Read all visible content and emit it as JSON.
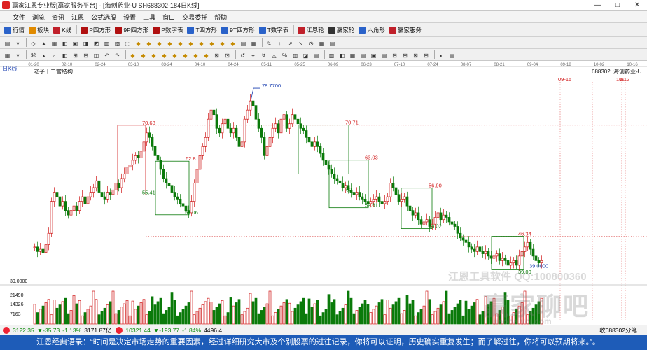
{
  "window": {
    "title": "赢家江恩专业版[赢家服务平台] - [海创药业-U SH688302-184日K线]",
    "controls": [
      "—",
      "□",
      "✕"
    ]
  },
  "menu": [
    "文件",
    "浏览",
    "资讯",
    "江恩",
    "公式选股",
    "设置",
    "工具",
    "窗口",
    "交易委托",
    "帮助"
  ],
  "toolbar1": [
    {
      "label": "行情",
      "icon": "grid-icon",
      "color": "#2a62c9"
    },
    {
      "label": "板块",
      "icon": "blocks-icon",
      "color": "#e08a00"
    },
    {
      "label": "K线",
      "icon": "kline-icon",
      "color": "#c0202a"
    },
    {
      "label": "P四方形",
      "icon": "square-p-icon",
      "color": "#b01010"
    },
    {
      "label": "9P四方形",
      "icon": "square-9p-icon",
      "color": "#b01010"
    },
    {
      "label": "P数字表",
      "icon": "table-p-icon",
      "color": "#b01010"
    },
    {
      "label": "T四方形",
      "icon": "square-t-icon",
      "color": "#2a62c9"
    },
    {
      "label": "9T四方形",
      "icon": "square-9t-icon",
      "color": "#2a62c9"
    },
    {
      "label": "T数字表",
      "icon": "table-t-icon",
      "color": "#2a62c9"
    },
    {
      "label": "江恩轮",
      "icon": "wheel-icon",
      "color": "#c0202a"
    },
    {
      "label": "赢家轮",
      "icon": "wheel2-icon",
      "color": "#333333"
    },
    {
      "label": "六角形",
      "icon": "hexagon-icon",
      "color": "#2a62c9"
    },
    {
      "label": "赢家服务",
      "icon": "service-icon",
      "color": "#c0202a"
    }
  ],
  "chart": {
    "period_label": "日K线",
    "title": "老子十二宫结构",
    "stock_code": "688302",
    "stock_name": "海创药业-U",
    "date_labels": [
      "01-20",
      "02-10",
      "02-24",
      "03-10",
      "03-24",
      "04-10",
      "04-24",
      "05-11",
      "05-25",
      "06-09",
      "06-23",
      "07-10",
      "07-24",
      "08-07",
      "08-21",
      "09-04",
      "09-18",
      "10-02",
      "10-16"
    ],
    "future_marks": [
      "09-15",
      "10-12",
      "11"
    ],
    "price_labels": [
      "78.7700",
      "70.68",
      "62.8",
      "55.41",
      "51.06",
      "70.71",
      "63.03",
      "60",
      "52.61",
      "56.90",
      "48.02",
      "46.34",
      "39.00",
      "39.0000"
    ],
    "left_axis": [
      "39.0000",
      "21490",
      "14326",
      "7163"
    ],
    "watermark1": "江恩工具软件  QQ:100800360",
    "watermark2": "赢家聊吧",
    "watermark3": "jiaoba.ycj.com"
  },
  "statusbar": {
    "sh_index": "3122.35",
    "sh_change": "▼-35.73",
    "sh_pct": "-1.13%",
    "sh_amount": "3171.87亿",
    "sz_index": "10321.44",
    "sz_change": "▼-193.77",
    "sz_pct": "-1.84%",
    "sz_amount": "4496.4",
    "right_text": "收688302分笔"
  },
  "quote": {
    "text": "江恩经典语录：“时间是决定市场走势的重要因素，经过详细研究大市及个别股票的过往记录，你将可以证明，历史确实重复发生；而了解过往，你将可以预期将来。”。"
  },
  "colors": {
    "candle_down": "#0a7a0a",
    "candle_up": "#d01818",
    "box_red": "#d01818",
    "box_green": "#0a7a0a",
    "quote_bar": "#1e5cb8"
  }
}
